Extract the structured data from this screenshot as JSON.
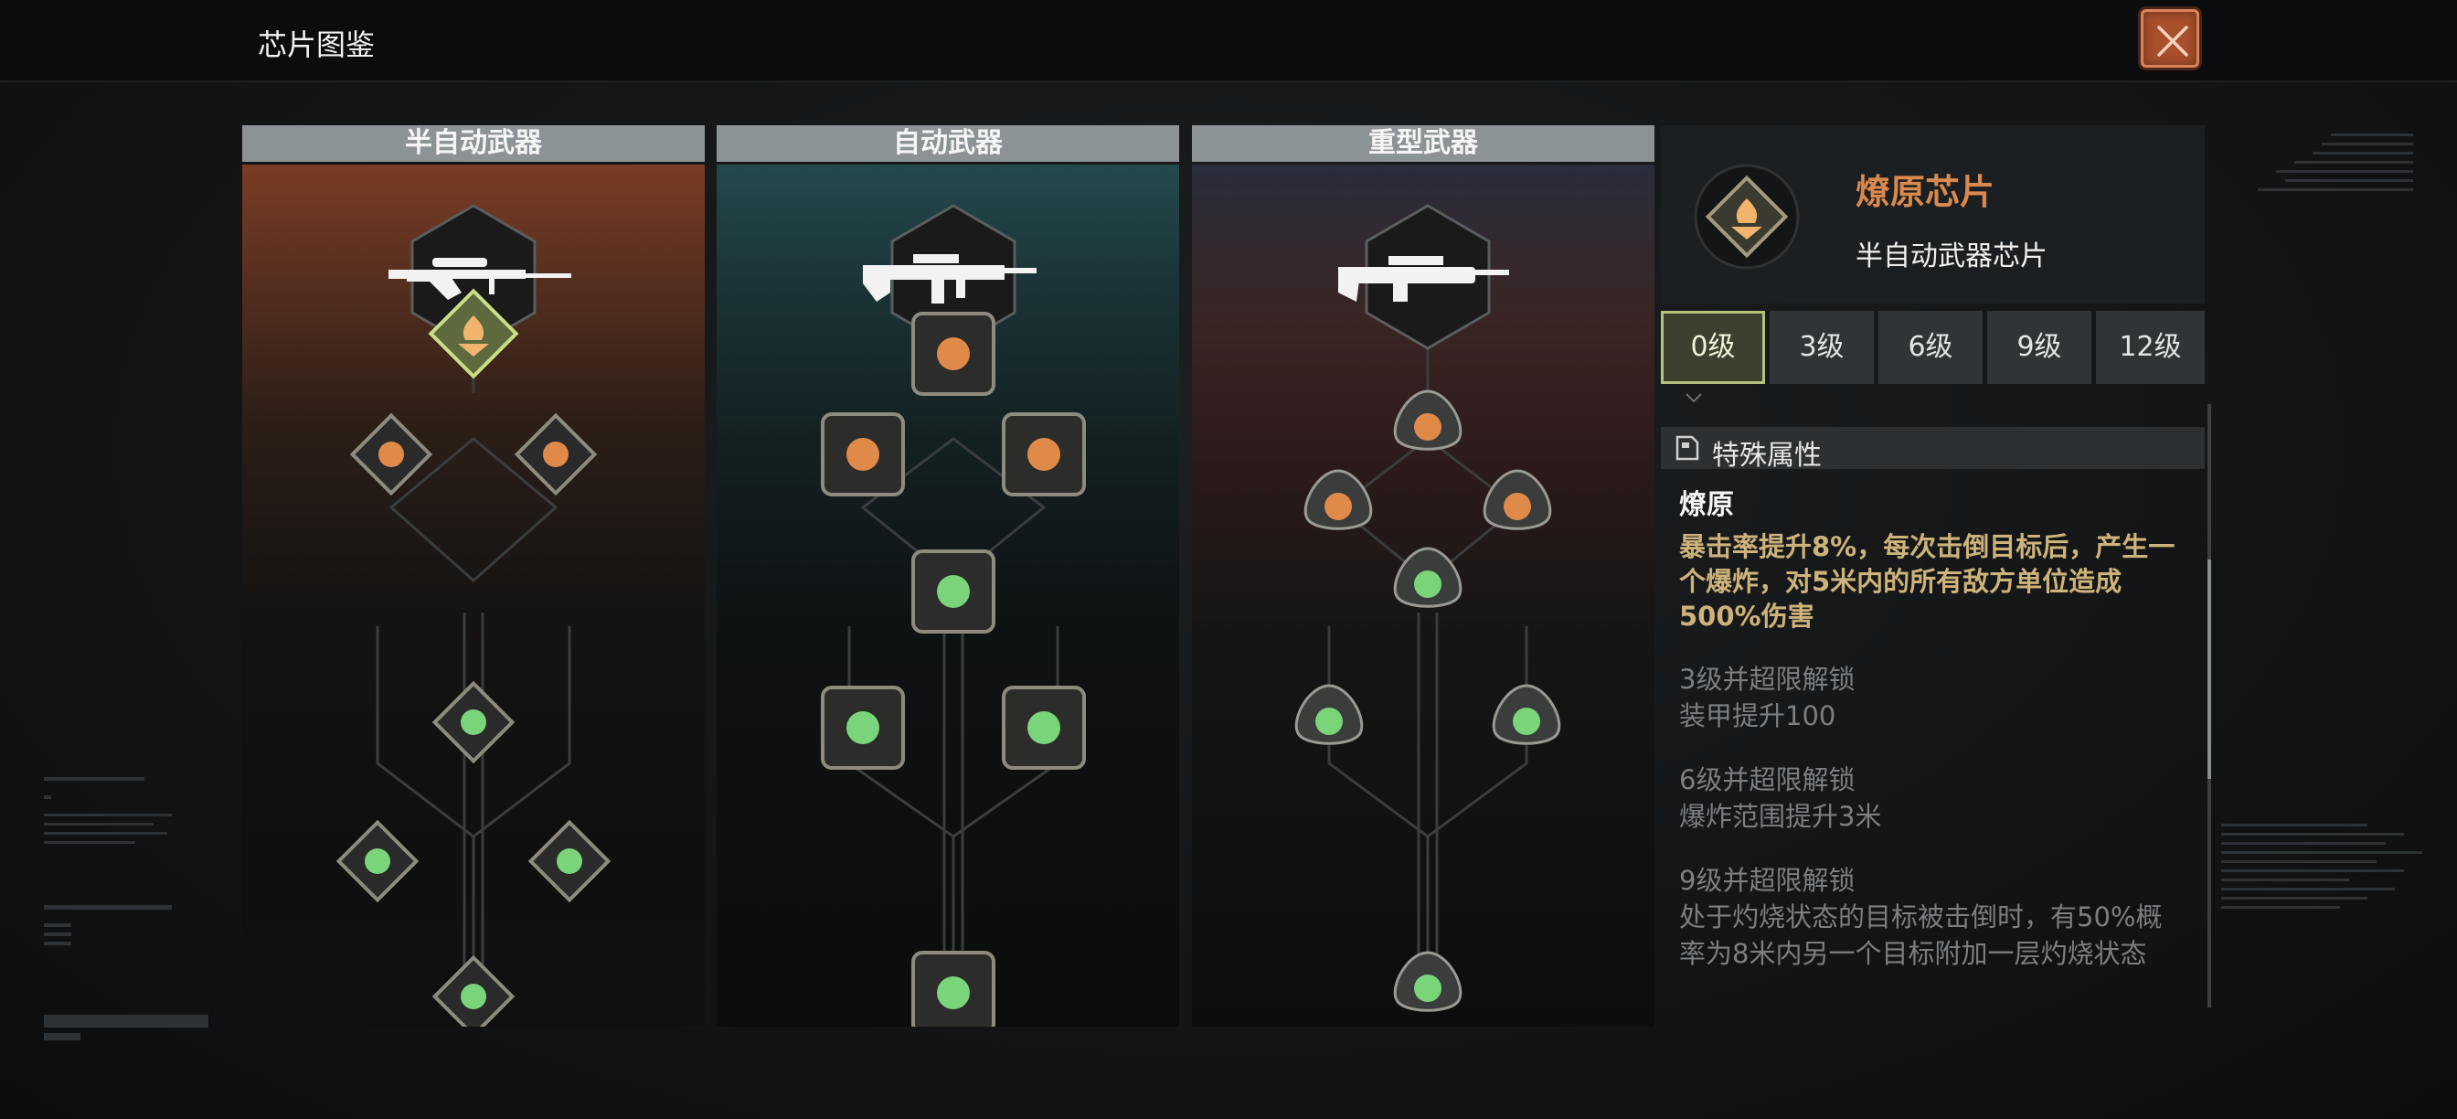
{
  "window": {
    "title": "芯片图鉴"
  },
  "colors": {
    "accent_orange": "#d9894d",
    "active_tab_border": "#b3c47a",
    "desc_gold": "#cdb27a",
    "locked_gray": "#7b7f82",
    "close_bg": "#a84f2c"
  },
  "columns": [
    {
      "id": "semi",
      "title": "半自动武器",
      "weapon_icon": "sniper-rifle-icon",
      "node_shape": "diamond"
    },
    {
      "id": "auto",
      "title": "自动武器",
      "weapon_icon": "assault-rifle-icon",
      "node_shape": "square"
    },
    {
      "id": "heavy",
      "title": "重型武器",
      "weapon_icon": "machine-gun-icon",
      "node_shape": "tri-lobe"
    }
  ],
  "detail": {
    "chip_name": "燎原芯片",
    "chip_type": "半自动武器芯片",
    "chip_icon": "flame-chip-icon",
    "levels": [
      "0级",
      "3级",
      "6级",
      "9级",
      "12级"
    ],
    "selected_level": "0级",
    "section_title": "特殊属性",
    "attribute": {
      "name": "燎原",
      "description": "暴击率提升8%，每次击倒目标后，产生一个爆炸，对5米内的所有敌方单位造成500%伤害"
    },
    "unlocks": [
      {
        "title": "3级并超限解锁",
        "desc": "装甲提升100"
      },
      {
        "title": "6级并超限解锁",
        "desc": "爆炸范围提升3米"
      },
      {
        "title": "9级并超限解锁",
        "desc": "处于灼烧状态的目标被击倒时，有50%概率为8米内另一个目标附加一层灼烧状态"
      }
    ]
  }
}
